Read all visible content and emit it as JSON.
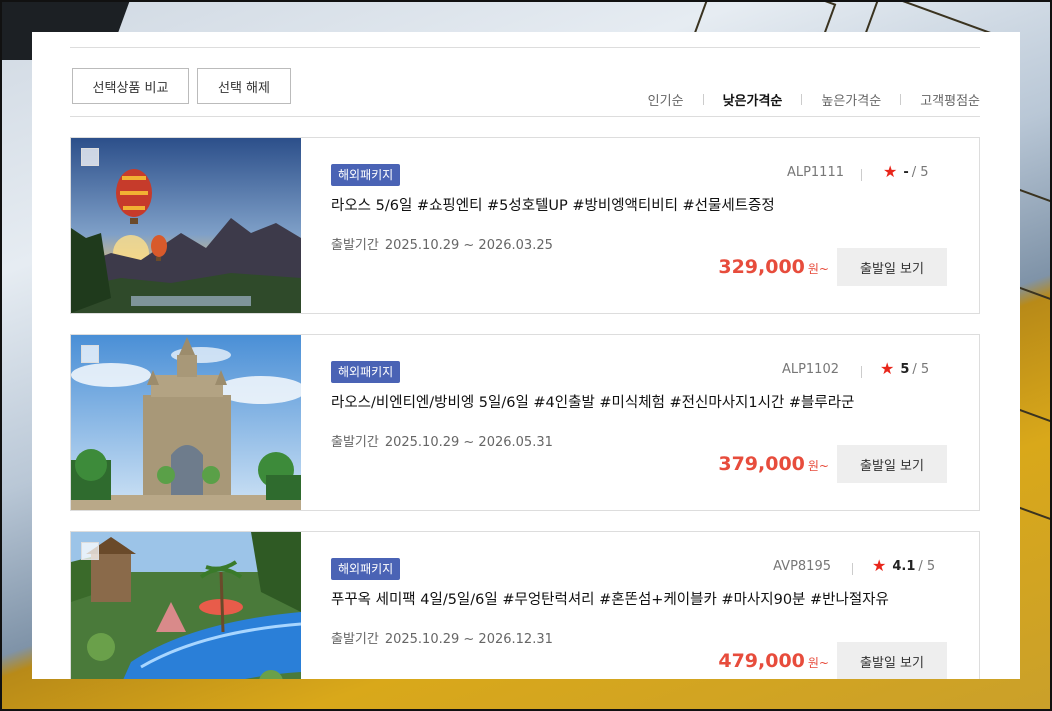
{
  "toolbar": {
    "compare_label": "선택상품 비교",
    "clear_label": "선택 해제"
  },
  "sort": {
    "options": [
      "인기순",
      "낮은가격순",
      "높은가격순",
      "고객평점순"
    ],
    "active_index": 1
  },
  "products": [
    {
      "badge": "해외패키지",
      "code": "ALP1111",
      "rating": "-",
      "rating_max": "/ 5",
      "title": "라오스 5/6일 #쇼핑엔티 #5성호텔UP #방비엥액티비티 #선물세트증정",
      "period_label": "출발기간",
      "period": "2025.10.29 ~ 2026.03.25",
      "price": "329,000",
      "price_unit": "원~",
      "button": "출발일 보기",
      "image": "hot-air-balloons-over-mountains"
    },
    {
      "badge": "해외패키지",
      "code": "ALP1102",
      "rating": "5",
      "rating_max": "/ 5",
      "title": "라오스/비엔티엔/방비엥 5일/6일 #4인출발 #미식체험 #전신마사지1시간 #블루라군",
      "period_label": "출발기간",
      "period": "2025.10.29 ~ 2026.05.31",
      "price": "379,000",
      "price_unit": "원~",
      "button": "출발일 보기",
      "image": "patuxai-monument"
    },
    {
      "badge": "해외패키지",
      "code": "AVP8195",
      "rating": "4.1",
      "rating_max": "/ 5",
      "title": "푸꾸옥 세미팩 4일/5일/6일 #무엉탄럭셔리 #혼똔섬+케이블카 #마사지90분 #반나절자유",
      "period_label": "출발기간",
      "period": "2025.10.29 ~ 2026.12.31",
      "price": "479,000",
      "price_unit": "원~",
      "button": "출발일 보기",
      "image": "resort-pool-with-palms"
    }
  ],
  "colors": {
    "badge": "#4a63b5",
    "price": "#e74c3c",
    "star": "#e8261b"
  }
}
